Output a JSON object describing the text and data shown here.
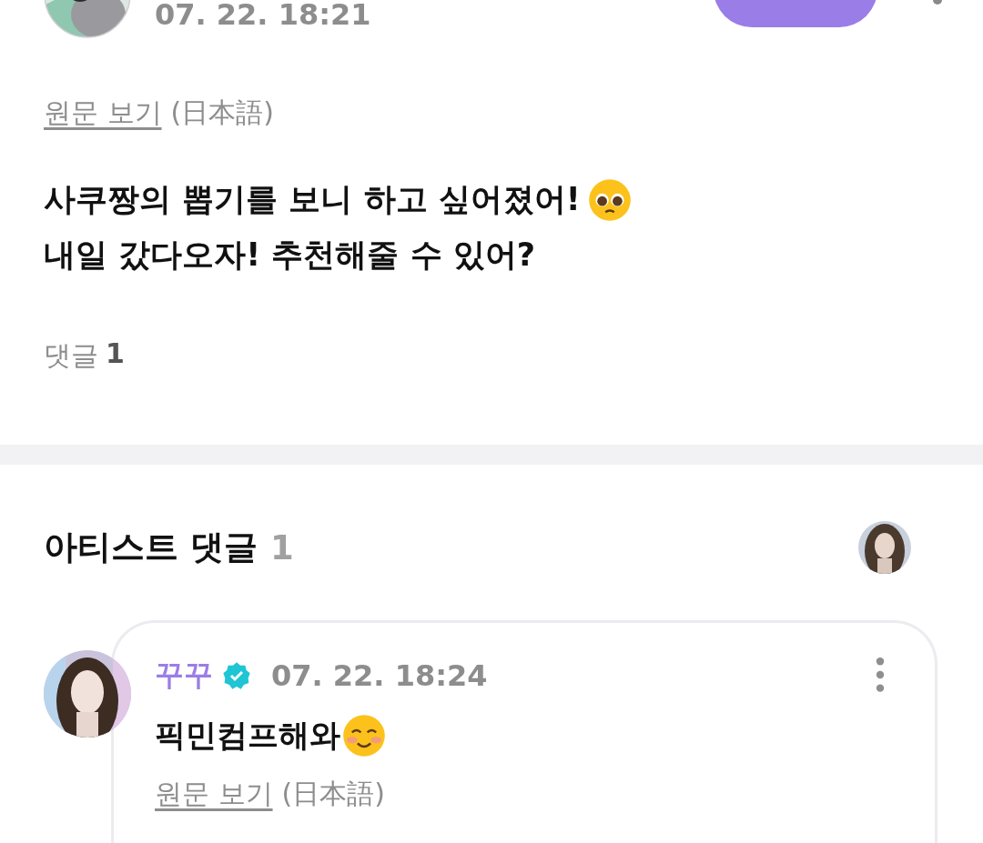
{
  "post": {
    "date": "07. 22. 18:21",
    "translation_link": "원문 보기",
    "translation_lang": "(日本語)",
    "body_lines": [
      {
        "text": "사쿠짱의 뽑기를 보니 하고 싶어졌어!",
        "kind": "pleading"
      },
      {
        "text": "내일 갔다오자! 추천해줄 수 있어?"
      }
    ],
    "comment_label": "댓글",
    "comment_count": "1"
  },
  "artist_comments": {
    "title": "아티스트 댓글",
    "count": "1",
    "comments": [
      {
        "author": "꾸꾸",
        "verified": true,
        "date": "07. 22. 18:24",
        "text": "픽민컴프해와",
        "kind": "smiling",
        "translation_link": "원문 보기",
        "translation_lang": "(日本語)"
      }
    ]
  }
}
